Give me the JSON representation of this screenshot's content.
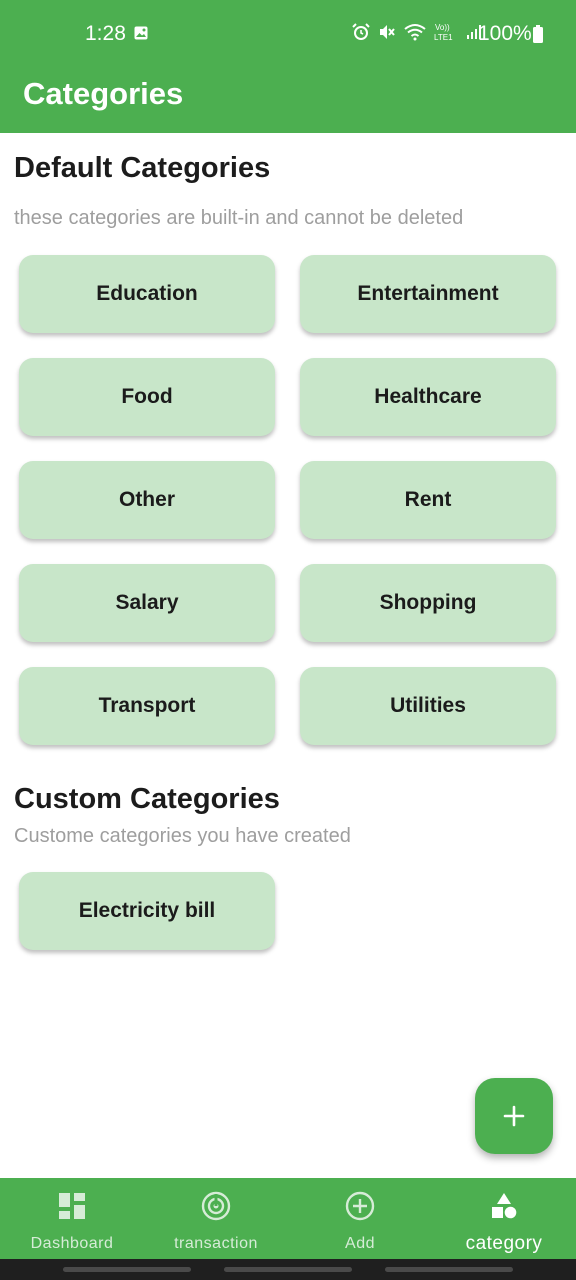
{
  "status_bar": {
    "time": "1:28",
    "battery": "100%",
    "icons": [
      "photo-icon",
      "alarm-icon",
      "mute-icon",
      "wifi-icon",
      "volte-icon",
      "signal-icon",
      "battery-icon"
    ],
    "volte_text": "Vo)) LTE1"
  },
  "app_bar": {
    "title": "Categories"
  },
  "default_section": {
    "title": "Default Categories",
    "subtitle": "these categories are built-in and cannot be deleted",
    "items": [
      "Education",
      "Entertainment",
      "Food",
      "Healthcare",
      "Other",
      "Rent",
      "Salary",
      "Shopping",
      "Transport",
      "Utilities"
    ]
  },
  "custom_section": {
    "title": "Custom Categories",
    "subtitle": "Custome categories you have created",
    "items": [
      "Electricity bill"
    ]
  },
  "fab": {
    "icon": "plus-icon"
  },
  "bottom_nav": {
    "items": [
      {
        "label": "Dashboard",
        "icon": "dashboard-icon"
      },
      {
        "label": "transaction",
        "icon": "transaction-icon"
      },
      {
        "label": "Add",
        "icon": "add-circle-icon"
      },
      {
        "label": "category",
        "icon": "category-icon"
      }
    ],
    "active": "category"
  },
  "colors": {
    "primary": "#4caf50",
    "chip": "#c8e6c9",
    "subtitle": "#9e9e9e",
    "text": "#1c1c1c"
  }
}
